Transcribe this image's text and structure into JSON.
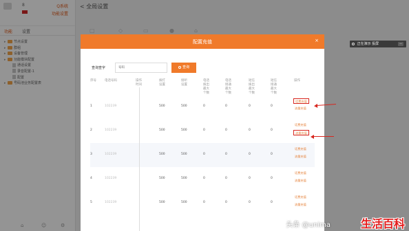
{
  "app": {
    "user_number": "8",
    "logout_label": "Q系统",
    "setup_label": "功能设置",
    "title": "< 全局设置",
    "sidebar_tabs": [
      "功能",
      "设置"
    ],
    "tree": [
      {
        "label": "节点设置",
        "level": 0,
        "kind": "folder"
      },
      {
        "label": "群组",
        "level": 0,
        "kind": "folder"
      },
      {
        "label": "设备管理",
        "level": 0,
        "kind": "folder"
      },
      {
        "label": "功能模块配置",
        "level": 0,
        "kind": "folder"
      },
      {
        "label": "通话设置",
        "level": 1,
        "kind": "doc"
      },
      {
        "label": "录音配置-1",
        "level": 1,
        "kind": "doc"
      },
      {
        "label": "配置",
        "level": 1,
        "kind": "doc"
      },
      {
        "label": "号码池业务配置表",
        "level": 0,
        "kind": "folder"
      }
    ]
  },
  "notification": {
    "text": "正在演示 投屏",
    "action": "—"
  },
  "modal": {
    "title": "配置充值",
    "close": "×",
    "search": {
      "label": "查询查字",
      "placeholder": "号码",
      "button": "查询"
    },
    "columns": [
      "序号",
      "电话号码",
      "操作\n时间",
      "拨打\n设置",
      "接听\n设置",
      "电话\n拨出\n最大\n个数",
      "电话\n接通\n最大\n个数",
      "短信\n拨出\n最大\n个数",
      "短信\n接通\n最大\n个数",
      "操作"
    ],
    "rows": [
      {
        "idx": "1",
        "phone": "102239",
        "setting1": "500",
        "setting2": "500",
        "a": "0",
        "b": "0",
        "c": "0",
        "d": "0"
      },
      {
        "idx": "2",
        "phone": "102239",
        "setting1": "500",
        "setting2": "500",
        "a": "0",
        "b": "0",
        "c": "0",
        "d": "0"
      },
      {
        "idx": "3",
        "phone": "102239",
        "setting1": "500",
        "setting2": "500",
        "a": "0",
        "b": "0",
        "c": "0",
        "d": "0"
      },
      {
        "idx": "4",
        "phone": "102239",
        "setting1": "500",
        "setting2": "500",
        "a": "0",
        "b": "0",
        "c": "0",
        "d": "0"
      },
      {
        "idx": "5",
        "phone": "102239",
        "setting1": "500",
        "setting2": "500",
        "a": "0",
        "b": "0",
        "c": "0",
        "d": "0"
      }
    ],
    "op_recharge": "话费充值",
    "op_package": "流量充值"
  },
  "watermark": {
    "by": "头条 @unima",
    "brand": "生活百科"
  },
  "colors": {
    "accent": "#f07a2a",
    "annotation": "#d8261e"
  }
}
